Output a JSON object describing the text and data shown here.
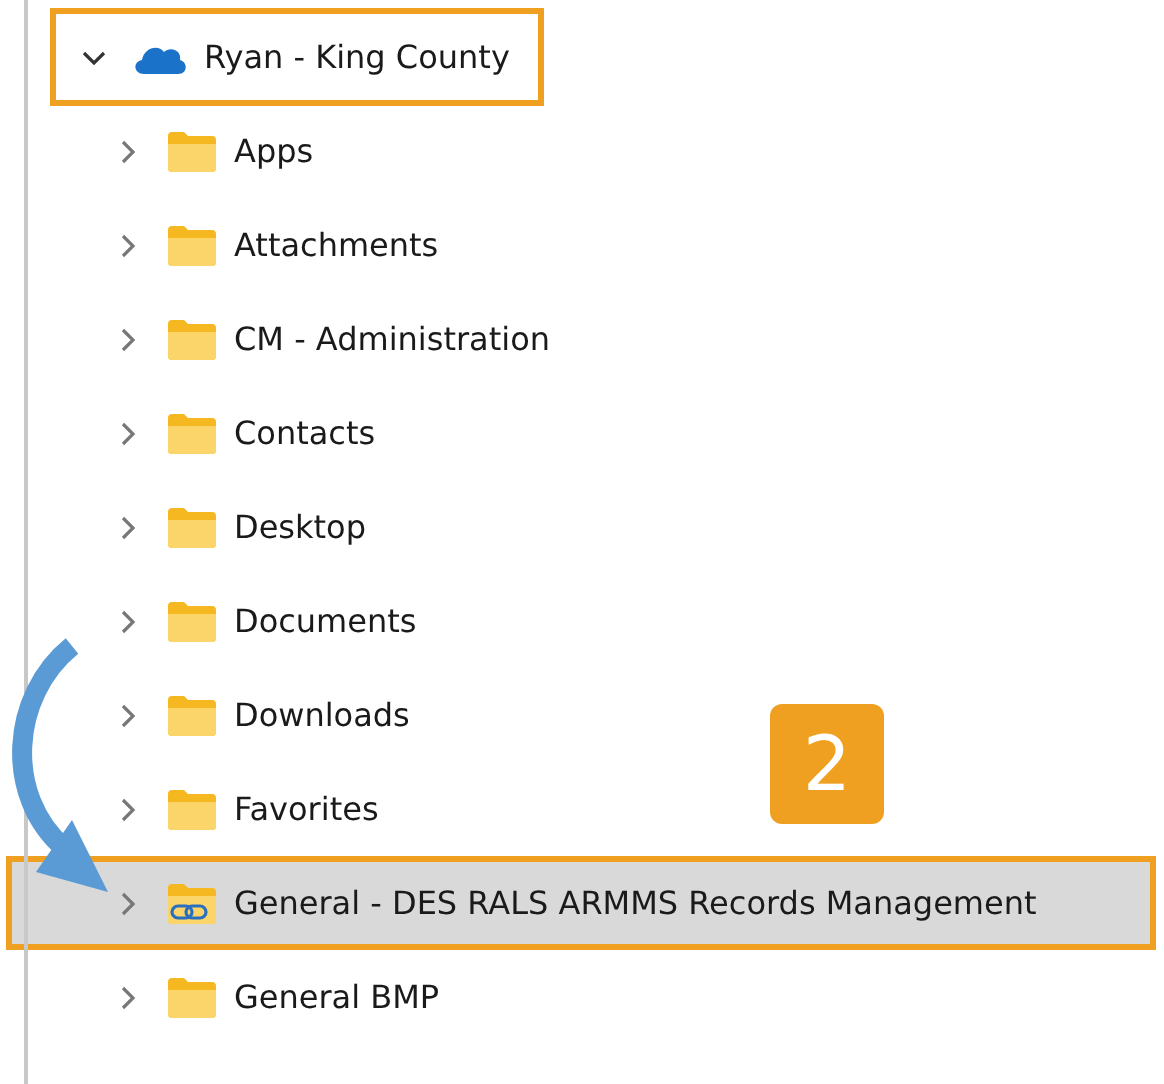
{
  "tree": {
    "label": "Ryan - King County",
    "kind": "cloud",
    "expanded": true,
    "highlighted": true,
    "children": [
      {
        "label": "Apps",
        "kind": "folder",
        "expanded": false,
        "selected": false,
        "highlighted": false
      },
      {
        "label": "Attachments",
        "kind": "folder",
        "expanded": false,
        "selected": false,
        "highlighted": false
      },
      {
        "label": "CM - Administration",
        "kind": "folder",
        "expanded": false,
        "selected": false,
        "highlighted": false
      },
      {
        "label": "Contacts",
        "kind": "folder",
        "expanded": false,
        "selected": false,
        "highlighted": false
      },
      {
        "label": "Desktop",
        "kind": "folder",
        "expanded": false,
        "selected": false,
        "highlighted": false
      },
      {
        "label": "Documents",
        "kind": "folder",
        "expanded": false,
        "selected": false,
        "highlighted": false
      },
      {
        "label": "Downloads",
        "kind": "folder",
        "expanded": false,
        "selected": false,
        "highlighted": false
      },
      {
        "label": "Favorites",
        "kind": "folder",
        "expanded": false,
        "selected": false,
        "highlighted": false
      },
      {
        "label": "General - DES RALS ARMMS Records Management",
        "kind": "shared-folder",
        "expanded": false,
        "selected": true,
        "highlighted": true
      },
      {
        "label": "General BMP",
        "kind": "folder",
        "expanded": false,
        "selected": false,
        "highlighted": false
      }
    ]
  },
  "callout": {
    "label": "2"
  }
}
